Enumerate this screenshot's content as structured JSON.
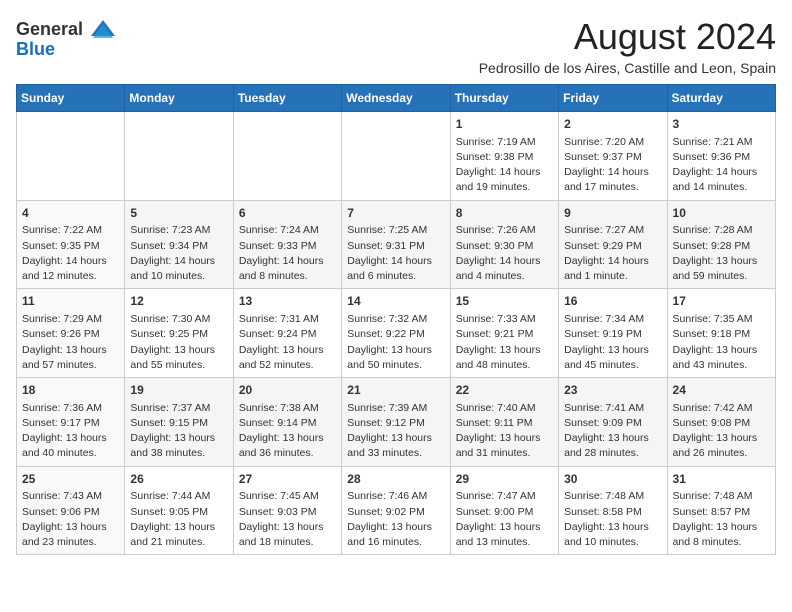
{
  "logo": {
    "general": "General",
    "blue": "Blue"
  },
  "title": "August 2024",
  "location": "Pedrosillo de los Aires, Castille and Leon, Spain",
  "days_of_week": [
    "Sunday",
    "Monday",
    "Tuesday",
    "Wednesday",
    "Thursday",
    "Friday",
    "Saturday"
  ],
  "weeks": [
    [
      {
        "day": "",
        "info": ""
      },
      {
        "day": "",
        "info": ""
      },
      {
        "day": "",
        "info": ""
      },
      {
        "day": "",
        "info": ""
      },
      {
        "day": "1",
        "info": "Sunrise: 7:19 AM\nSunset: 9:38 PM\nDaylight: 14 hours and 19 minutes."
      },
      {
        "day": "2",
        "info": "Sunrise: 7:20 AM\nSunset: 9:37 PM\nDaylight: 14 hours and 17 minutes."
      },
      {
        "day": "3",
        "info": "Sunrise: 7:21 AM\nSunset: 9:36 PM\nDaylight: 14 hours and 14 minutes."
      }
    ],
    [
      {
        "day": "4",
        "info": "Sunrise: 7:22 AM\nSunset: 9:35 PM\nDaylight: 14 hours and 12 minutes."
      },
      {
        "day": "5",
        "info": "Sunrise: 7:23 AM\nSunset: 9:34 PM\nDaylight: 14 hours and 10 minutes."
      },
      {
        "day": "6",
        "info": "Sunrise: 7:24 AM\nSunset: 9:33 PM\nDaylight: 14 hours and 8 minutes."
      },
      {
        "day": "7",
        "info": "Sunrise: 7:25 AM\nSunset: 9:31 PM\nDaylight: 14 hours and 6 minutes."
      },
      {
        "day": "8",
        "info": "Sunrise: 7:26 AM\nSunset: 9:30 PM\nDaylight: 14 hours and 4 minutes."
      },
      {
        "day": "9",
        "info": "Sunrise: 7:27 AM\nSunset: 9:29 PM\nDaylight: 14 hours and 1 minute."
      },
      {
        "day": "10",
        "info": "Sunrise: 7:28 AM\nSunset: 9:28 PM\nDaylight: 13 hours and 59 minutes."
      }
    ],
    [
      {
        "day": "11",
        "info": "Sunrise: 7:29 AM\nSunset: 9:26 PM\nDaylight: 13 hours and 57 minutes."
      },
      {
        "day": "12",
        "info": "Sunrise: 7:30 AM\nSunset: 9:25 PM\nDaylight: 13 hours and 55 minutes."
      },
      {
        "day": "13",
        "info": "Sunrise: 7:31 AM\nSunset: 9:24 PM\nDaylight: 13 hours and 52 minutes."
      },
      {
        "day": "14",
        "info": "Sunrise: 7:32 AM\nSunset: 9:22 PM\nDaylight: 13 hours and 50 minutes."
      },
      {
        "day": "15",
        "info": "Sunrise: 7:33 AM\nSunset: 9:21 PM\nDaylight: 13 hours and 48 minutes."
      },
      {
        "day": "16",
        "info": "Sunrise: 7:34 AM\nSunset: 9:19 PM\nDaylight: 13 hours and 45 minutes."
      },
      {
        "day": "17",
        "info": "Sunrise: 7:35 AM\nSunset: 9:18 PM\nDaylight: 13 hours and 43 minutes."
      }
    ],
    [
      {
        "day": "18",
        "info": "Sunrise: 7:36 AM\nSunset: 9:17 PM\nDaylight: 13 hours and 40 minutes."
      },
      {
        "day": "19",
        "info": "Sunrise: 7:37 AM\nSunset: 9:15 PM\nDaylight: 13 hours and 38 minutes."
      },
      {
        "day": "20",
        "info": "Sunrise: 7:38 AM\nSunset: 9:14 PM\nDaylight: 13 hours and 36 minutes."
      },
      {
        "day": "21",
        "info": "Sunrise: 7:39 AM\nSunset: 9:12 PM\nDaylight: 13 hours and 33 minutes."
      },
      {
        "day": "22",
        "info": "Sunrise: 7:40 AM\nSunset: 9:11 PM\nDaylight: 13 hours and 31 minutes."
      },
      {
        "day": "23",
        "info": "Sunrise: 7:41 AM\nSunset: 9:09 PM\nDaylight: 13 hours and 28 minutes."
      },
      {
        "day": "24",
        "info": "Sunrise: 7:42 AM\nSunset: 9:08 PM\nDaylight: 13 hours and 26 minutes."
      }
    ],
    [
      {
        "day": "25",
        "info": "Sunrise: 7:43 AM\nSunset: 9:06 PM\nDaylight: 13 hours and 23 minutes."
      },
      {
        "day": "26",
        "info": "Sunrise: 7:44 AM\nSunset: 9:05 PM\nDaylight: 13 hours and 21 minutes."
      },
      {
        "day": "27",
        "info": "Sunrise: 7:45 AM\nSunset: 9:03 PM\nDaylight: 13 hours and 18 minutes."
      },
      {
        "day": "28",
        "info": "Sunrise: 7:46 AM\nSunset: 9:02 PM\nDaylight: 13 hours and 16 minutes."
      },
      {
        "day": "29",
        "info": "Sunrise: 7:47 AM\nSunset: 9:00 PM\nDaylight: 13 hours and 13 minutes."
      },
      {
        "day": "30",
        "info": "Sunrise: 7:48 AM\nSunset: 8:58 PM\nDaylight: 13 hours and 10 minutes."
      },
      {
        "day": "31",
        "info": "Sunrise: 7:48 AM\nSunset: 8:57 PM\nDaylight: 13 hours and 8 minutes."
      }
    ]
  ]
}
